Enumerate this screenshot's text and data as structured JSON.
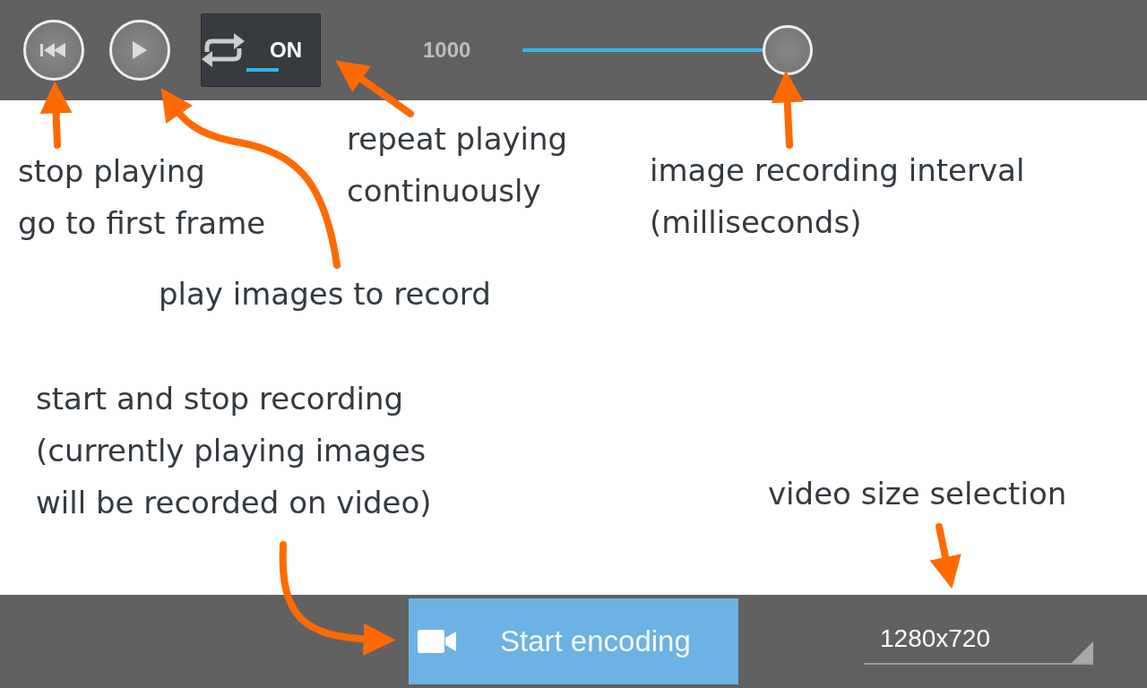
{
  "toolbar": {
    "repeat_toggle": {
      "label": "ON",
      "on": true
    },
    "interval": {
      "reading": "1000",
      "level": 1
    }
  },
  "annotations": [
    {
      "text": "repeat playing\ncontinuously"
    },
    {
      "text": "stop playing\ngo to first frame"
    },
    {
      "text": "image recording interval\n(milliseconds)"
    },
    {
      "text": "play images to record"
    },
    {
      "text": "start and stop recording\n(currently playing images\nwill be recorded on video)"
    },
    {
      "text": "video size selection"
    }
  ],
  "bottom_bar": {
    "encode_button": {
      "label": "Start encoding"
    },
    "video_size": {
      "value": "1280x720"
    }
  }
}
